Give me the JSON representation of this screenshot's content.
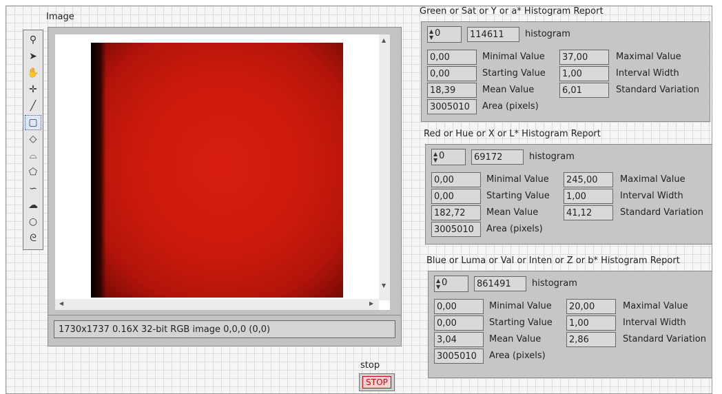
{
  "image_panel": {
    "label": "Image",
    "status": "1730x1737 0.16X 32-bit RGB image 0,0,0    (0,0)"
  },
  "tools": [
    {
      "icon": "zoom-icon",
      "glyph": "⚲"
    },
    {
      "icon": "arrow-icon",
      "glyph": "➤"
    },
    {
      "icon": "pan-hand-icon",
      "glyph": "✋"
    },
    {
      "icon": "crosshair-icon",
      "glyph": "✛"
    },
    {
      "icon": "line-icon",
      "glyph": "╱"
    },
    {
      "icon": "rectangle-icon",
      "glyph": "▢"
    },
    {
      "icon": "rotated-rect-icon",
      "glyph": "◇"
    },
    {
      "icon": "annulus-icon",
      "glyph": "⌓"
    },
    {
      "icon": "polygon-icon",
      "glyph": "⬠"
    },
    {
      "icon": "freehand-line-icon",
      "glyph": "∽"
    },
    {
      "icon": "freehand-region-icon",
      "glyph": "☁"
    },
    {
      "icon": "oval-icon",
      "glyph": "○"
    },
    {
      "icon": "broken-line-icon",
      "glyph": "ᘓ"
    }
  ],
  "stop": {
    "label": "stop",
    "button": "STOP"
  },
  "reports": [
    {
      "title": "Green or Sat or Y or a* Histogram Report",
      "index": "0",
      "histogram_value": "114611",
      "histogram_label": "histogram",
      "min": "0,00",
      "min_label": "Minimal Value",
      "max": "37,00",
      "max_label": "Maximal Value",
      "start": "0,00",
      "start_label": "Starting Value",
      "interval": "1,00",
      "interval_label": "Interval Width",
      "mean": "18,39",
      "mean_label": "Mean Value",
      "std": "6,01",
      "std_label": "Standard Variation",
      "area": "3005010",
      "area_label": "Area (pixels)"
    },
    {
      "title": "Red or Hue or X or L* Histogram Report",
      "index": "0",
      "histogram_value": "69172",
      "histogram_label": "histogram",
      "min": "0,00",
      "min_label": "Minimal Value",
      "max": "245,00",
      "max_label": "Maximal Value",
      "start": "0,00",
      "start_label": "Starting Value",
      "interval": "1,00",
      "interval_label": "Interval Width",
      "mean": "182,72",
      "mean_label": "Mean Value",
      "std": "41,12",
      "std_label": "Standard Variation",
      "area": "3005010",
      "area_label": "Area (pixels)"
    },
    {
      "title": "Blue or Luma or Val or Inten or Z or b* Histogram Report",
      "index": "0",
      "histogram_value": "861491",
      "histogram_label": "histogram",
      "min": "0,00",
      "min_label": "Minimal Value",
      "max": "20,00",
      "max_label": "Maximal Value",
      "start": "0,00",
      "start_label": "Starting Value",
      "interval": "1,00",
      "interval_label": "Interval Width",
      "mean": "3,04",
      "mean_label": "Mean Value",
      "std": "2,86",
      "std_label": "Standard Variation",
      "area": "3005010",
      "area_label": "Area (pixels)"
    }
  ]
}
